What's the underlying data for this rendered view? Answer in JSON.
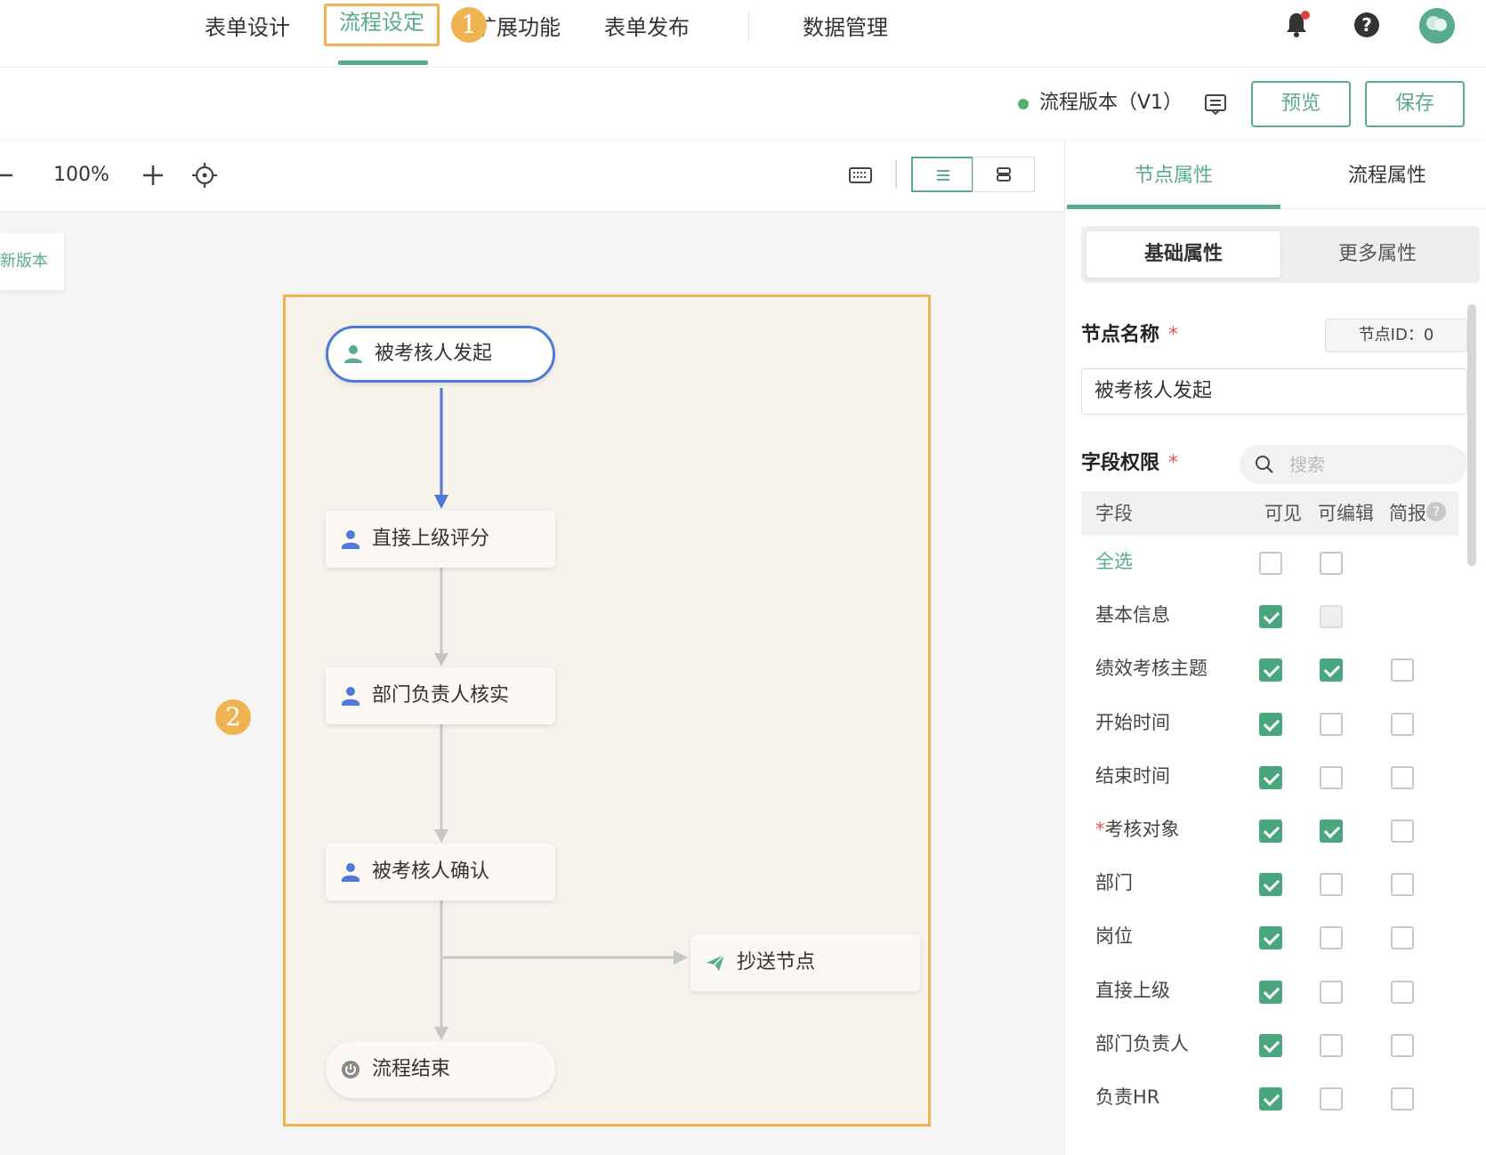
{
  "topnav": {
    "tabs": [
      {
        "label": "表单设计"
      },
      {
        "label": "流程设定"
      },
      {
        "label": "扩展功能"
      },
      {
        "label": "表单发布"
      },
      {
        "label": "数据管理"
      }
    ],
    "step_badge": "1",
    "notification": true
  },
  "subbar": {
    "version": "流程版本（V1）",
    "preview_label": "预览",
    "save_label": "保存"
  },
  "canvas": {
    "zoom": "100%",
    "new_version_label": "新版本",
    "area_badge": "2",
    "nodes": {
      "start": "被考核人发起",
      "n1": "直接上级评分",
      "n2": "部门负责人核实",
      "n3": "被考核人确认",
      "cc": "抄送节点",
      "end": "流程结束"
    }
  },
  "panel": {
    "tabs": [
      "节点属性",
      "流程属性"
    ],
    "subtabs": [
      "基础属性",
      "更多属性"
    ],
    "node_name_label": "节点名称",
    "required_mark": "*",
    "node_id": "节点ID：0",
    "node_name_value": "被考核人发起",
    "field_perm_label": "字段权限",
    "search_placeholder": "搜索",
    "headers": [
      "字段",
      "可见",
      "可编辑",
      "简报"
    ],
    "rows": [
      {
        "label": "全选",
        "visible": false,
        "editable": false,
        "brief": null
      },
      {
        "label": "基本信息",
        "visible": true,
        "editable": "disabled",
        "brief": null
      },
      {
        "label": "绩效考核主题",
        "visible": true,
        "editable": true,
        "brief": false
      },
      {
        "label": "开始时间",
        "visible": true,
        "editable": false,
        "brief": false
      },
      {
        "label": "结束时间",
        "visible": true,
        "editable": false,
        "brief": false
      },
      {
        "label": "考核对象",
        "required": true,
        "visible": true,
        "editable": true,
        "brief": false
      },
      {
        "label": "部门",
        "visible": true,
        "editable": false,
        "brief": false
      },
      {
        "label": "岗位",
        "visible": true,
        "editable": false,
        "brief": false
      },
      {
        "label": "直接上级",
        "visible": true,
        "editable": false,
        "brief": false
      },
      {
        "label": "部门负责人",
        "visible": true,
        "editable": false,
        "brief": false
      },
      {
        "label": "负责HR",
        "visible": true,
        "editable": false,
        "brief": false
      }
    ]
  },
  "colors": {
    "accent": "#5aab8e",
    "highlight": "#f0b352",
    "start_border": "#4d7ad6"
  }
}
